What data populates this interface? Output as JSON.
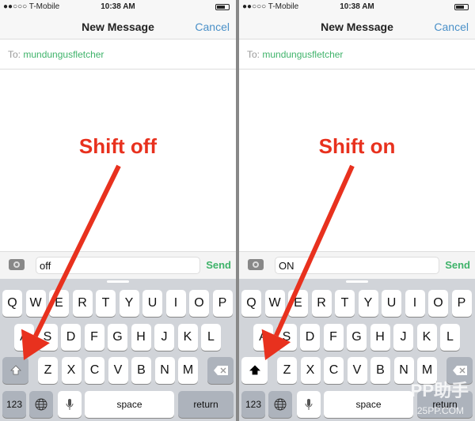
{
  "status": {
    "signal": "●●○○○ T-Mobile",
    "time": "10:38 AM"
  },
  "nav": {
    "title": "New Message",
    "cancel": "Cancel"
  },
  "to": {
    "label": "To:",
    "recipient": "mundungusfletcher"
  },
  "send_label": "Send",
  "keys": {
    "row1": [
      "Q",
      "W",
      "E",
      "R",
      "T",
      "Y",
      "U",
      "I",
      "O",
      "P"
    ],
    "row2": [
      "A",
      "S",
      "D",
      "F",
      "G",
      "H",
      "J",
      "K",
      "L"
    ],
    "row3": [
      "Z",
      "X",
      "C",
      "V",
      "B",
      "N",
      "M"
    ],
    "numbers": "123",
    "space": "space",
    "return": "return"
  },
  "panels": [
    {
      "annotation": "Shift off",
      "message": "off",
      "shift_on": false
    },
    {
      "annotation": "Shift on",
      "message": "ON",
      "shift_on": true
    }
  ],
  "watermark": {
    "logo": "PP助手",
    "url": "25PP.COM"
  },
  "colors": {
    "accent_green": "#3fb36a",
    "cancel_blue": "#4a90c8",
    "arrow_red": "#e8311e"
  }
}
